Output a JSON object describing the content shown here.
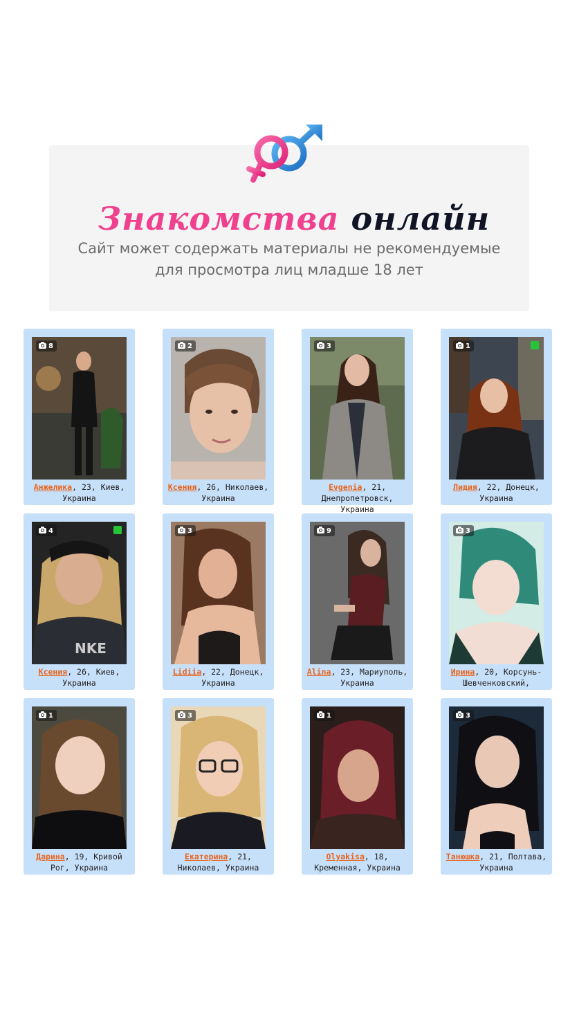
{
  "banner": {
    "title_part1": "Знакомства",
    "title_part2": "онлайн",
    "warning_line1": "Сайт может содержать материалы не рекомендуемые",
    "warning_line2": "для просмотра лиц младше 18 лет"
  },
  "colors": {
    "accent_pink": "#f0418f",
    "accent_blue": "#2f8fe0",
    "card_bg": "#c7e0fa",
    "name_link": "#e9631a",
    "online": "#27c43a"
  },
  "profiles": [
    {
      "name": "Анжелика",
      "details": ", 23, Киев, Украина",
      "photos": "8",
      "online": false
    },
    {
      "name": "Ксения",
      "details": ", 26, Николаев, Украина",
      "photos": "2",
      "online": false
    },
    {
      "name": "Evgenia",
      "details": ", 21, Днепропетровск, Украина",
      "photos": "3",
      "online": false
    },
    {
      "name": "Лидия",
      "details": ", 22, Донецк, Украина",
      "photos": "1",
      "online": true
    },
    {
      "name": "Ксения",
      "details": ", 26, Киев, Украина",
      "photos": "4",
      "online": true
    },
    {
      "name": "Lidiia",
      "details": ", 22, Донецк, Украина",
      "photos": "3",
      "online": false
    },
    {
      "name": "Alina",
      "details": ", 23, Мариуполь, Украина",
      "photos": "9",
      "online": false
    },
    {
      "name": "Ирина",
      "details": ", 20, Корсунь-Шевченковский,",
      "photos": "3",
      "online": false
    },
    {
      "name": "Дарина",
      "details": ", 19, Кривой Рог, Украина",
      "photos": "1",
      "online": false
    },
    {
      "name": "Екатерина",
      "details": ", 21, Николаев, Украина",
      "photos": "3",
      "online": false
    },
    {
      "name": "Olyakisa",
      "details": ", 18, Кременная, Украина",
      "photos": "1",
      "online": false
    },
    {
      "name": "Танюшка",
      "details": ", 21, Полтава, Украина",
      "photos": "3",
      "online": false
    }
  ]
}
